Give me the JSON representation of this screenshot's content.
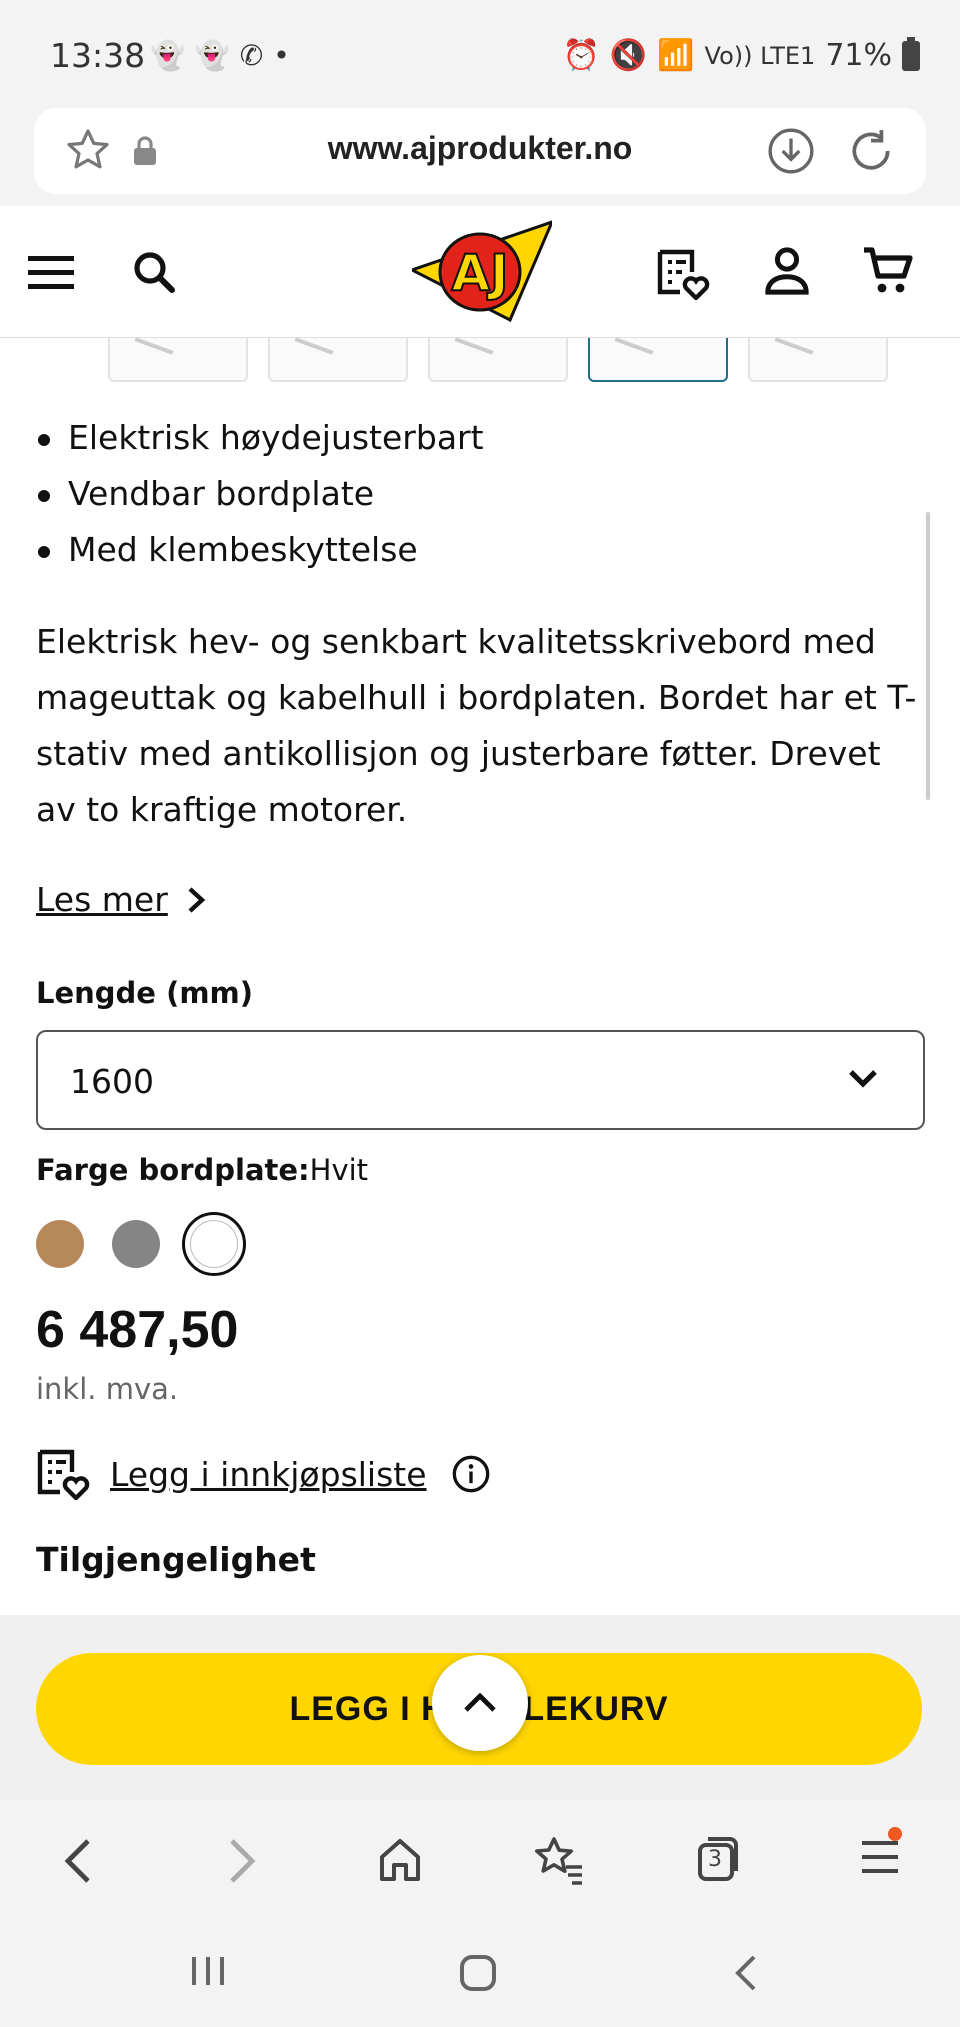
{
  "status": {
    "time": "13:38",
    "battery": "71%",
    "network": "Vo)) LTE1"
  },
  "browser": {
    "url": "www.ajprodukter.no",
    "tabs_count": "3"
  },
  "product": {
    "bullets": [
      "Elektrisk høydejusterbart",
      "Vendbar bordplate",
      "Med klembeskyttelse"
    ],
    "description": "Elektrisk hev- og senkbart kvalitetsskrivebord med mageuttak og kabelhull i bordplaten. Bordet har et T-stativ med antikollisjon og justerbare føtter. Drevet av to kraftige motorer.",
    "read_more": "Les mer",
    "length_label": "Lengde (mm)",
    "length_value": "1600",
    "color_label": "Farge bordplate:",
    "color_value": "Hvit",
    "swatches": [
      "#b5895a",
      "#858585",
      "#ffffff"
    ],
    "price": "6 487,50",
    "vat": "inkl. mva.",
    "shopping_list": "Legg i innkjøpsliste",
    "availability": "Tilgjengelighet",
    "add_to_cart": "LEGG I HANDLEKURV"
  },
  "colors": {
    "accent_yellow": "#ffd600",
    "logo_red": "#e2231a",
    "active_thumb": "#1f6e8c",
    "notification_dot": "#f05a22"
  }
}
